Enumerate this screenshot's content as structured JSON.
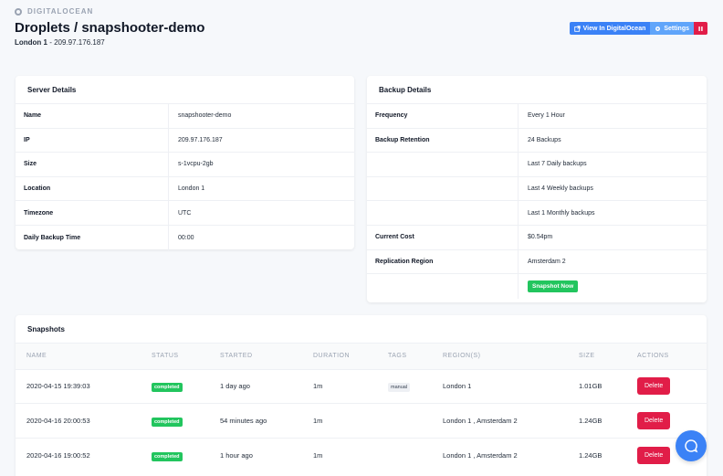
{
  "brand": "DIGITALOCEAN",
  "title": "Droplets / snapshooter-demo",
  "subtitle_bold": "London 1",
  "subtitle_rest": " - 209.97.176.187",
  "actions": {
    "view": "View In DigitalOcean",
    "settings": "Settings"
  },
  "server": {
    "title": "Server Details",
    "rows": [
      {
        "k": "Name",
        "v": "snapshooter-demo"
      },
      {
        "k": "IP",
        "v": "209.97.176.187"
      },
      {
        "k": "Size",
        "v": "s-1vcpu-2gb"
      },
      {
        "k": "Location",
        "v": "London 1"
      },
      {
        "k": "Timezone",
        "v": "UTC"
      },
      {
        "k": "Daily Backup Time",
        "v": "00:00"
      }
    ]
  },
  "backup": {
    "title": "Backup Details",
    "rows": [
      {
        "k": "Frequency",
        "v": "Every 1 Hour"
      },
      {
        "k": "Backup Retention",
        "v": "24 Backups"
      },
      {
        "k": "",
        "v": "Last 7 Daily backups"
      },
      {
        "k": "",
        "v": "Last 4 Weekly backups"
      },
      {
        "k": "",
        "v": "Last 1 Monthly backups"
      },
      {
        "k": "Current Cost",
        "v": "$0.54pm"
      },
      {
        "k": "Replication Region",
        "v": "Amsterdam 2"
      }
    ],
    "snapshot_now": "Snapshot Now"
  },
  "snapshots": {
    "title": "Snapshots",
    "columns": [
      "NAME",
      "STATUS",
      "STARTED",
      "DURATION",
      "TAGS",
      "REGION(S)",
      "SIZE",
      "ACTIONS"
    ],
    "rows": [
      {
        "name": "2020-04-15 19:39:03",
        "status": "completed",
        "started": "1 day ago",
        "duration": "1m",
        "tag": "manual",
        "regions": "London 1",
        "size": "1.01GB",
        "action": "Delete"
      },
      {
        "name": "2020-04-16 20:00:53",
        "status": "completed",
        "started": "54 minutes ago",
        "duration": "1m",
        "tag": "",
        "regions": "London 1 , Amsterdam 2",
        "size": "1.24GB",
        "action": "Delete"
      },
      {
        "name": "2020-04-16 19:00:52",
        "status": "completed",
        "started": "1 hour ago",
        "duration": "1m",
        "tag": "",
        "regions": "London 1 , Amsterdam 2",
        "size": "1.24GB",
        "action": "Delete"
      }
    ]
  },
  "colors": {
    "primary": "#3b82f6",
    "danger": "#e11d48",
    "success": "#22c55e"
  }
}
